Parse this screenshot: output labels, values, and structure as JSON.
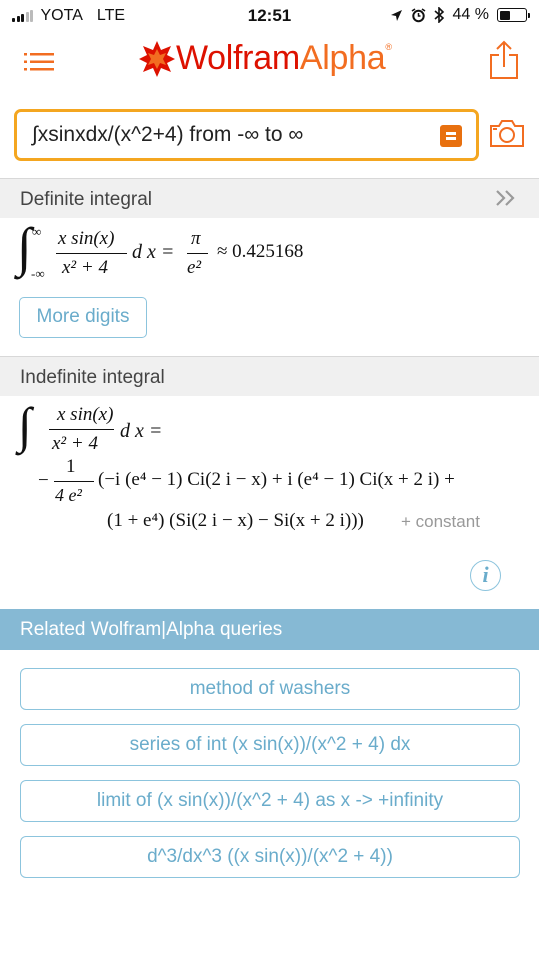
{
  "status": {
    "carrier": "YOTA",
    "network": "LTE",
    "time": "12:51",
    "battery_text": "44 %",
    "battery_level": 0.44
  },
  "header": {
    "logo_main": "Wolfram",
    "logo_alpha": "Alpha",
    "logo_reg": "®"
  },
  "search": {
    "value": "∫xsinxdx/(x^2+4) from -∞ to ∞"
  },
  "pods": {
    "definite": {
      "title": "Definite integral",
      "upper_limit": "∞",
      "lower_limit": "-∞",
      "numerator": "x sin(x)",
      "denominator": "x² + 4",
      "dx": "d x =",
      "result_num": "π",
      "result_den": "e²",
      "approx": "≈ 0.425168",
      "more_digits_label": "More digits"
    },
    "indefinite": {
      "title": "Indefinite integral",
      "numerator": "x sin(x)",
      "denominator": "x² + 4",
      "dx": "d x =",
      "coef_num": "1",
      "coef_den": "4 e²",
      "line2": "(−i (e⁴ − 1) Ci(2 i − x) + i (e⁴ − 1) Ci(x + 2 i) +",
      "line3": "(1 + e⁴) (Si(2 i − x) − Si(x + 2 i)))",
      "constant": "+ constant",
      "info_label": "i"
    }
  },
  "related": {
    "title": "Related Wolfram|Alpha queries",
    "items": [
      "method of washers",
      "series of int (x sin(x))/(x^2 + 4) dx",
      "limit of (x sin(x))/(x^2 + 4) as x -> +infinity",
      "d^3/dx^3 ((x sin(x))/(x^2 + 4))"
    ]
  },
  "colors": {
    "brand_red": "#dd1100",
    "brand_orange": "#f26d21",
    "input_border": "#f4a620",
    "link_blue": "#6aaccb",
    "related_header": "#86b9d4"
  },
  "icons": [
    "menu-icon",
    "wolfram-star-icon",
    "share-icon",
    "equals-icon",
    "camera-icon",
    "double-chevron-right-icon",
    "info-icon"
  ]
}
